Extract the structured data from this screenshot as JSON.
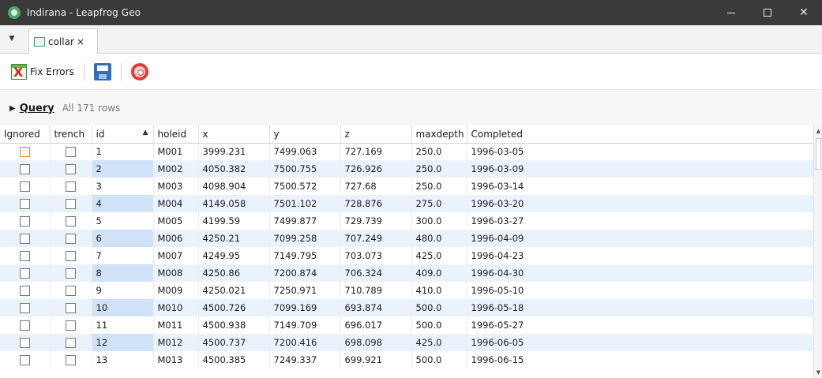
{
  "window": {
    "title": "Indirana - Leapfrog Geo",
    "minimize": "—",
    "maximize": "□",
    "close": "✕"
  },
  "tabs": [
    {
      "label": "collar",
      "close": "×"
    }
  ],
  "tab_menu_glyph": "▼",
  "toolbar": {
    "fix_errors_label": "Fix Errors",
    "fix_icon_glyph": "X"
  },
  "query": {
    "arrow": "▶",
    "label": "Query",
    "rows_text": "All 171 rows"
  },
  "grid": {
    "columns": [
      "Ignored",
      "trench",
      "id",
      "holeid",
      "x",
      "y",
      "z",
      "maxdepth",
      "Completed"
    ],
    "sort_arrow": "▲",
    "rows": [
      {
        "ignored": false,
        "trench": false,
        "id": "1",
        "holeid": "M001",
        "x": "3999.231",
        "y": "7499.063",
        "z": "727.169",
        "maxdepth": "250.0",
        "completed": "1996-03-05"
      },
      {
        "ignored": false,
        "trench": false,
        "id": "2",
        "holeid": "M002",
        "x": "4050.382",
        "y": "7500.755",
        "z": "726.926",
        "maxdepth": "250.0",
        "completed": "1996-03-09"
      },
      {
        "ignored": false,
        "trench": false,
        "id": "3",
        "holeid": "M003",
        "x": "4098.904",
        "y": "7500.572",
        "z": "727.68",
        "maxdepth": "250.0",
        "completed": "1996-03-14"
      },
      {
        "ignored": false,
        "trench": false,
        "id": "4",
        "holeid": "M004",
        "x": "4149.058",
        "y": "7501.102",
        "z": "728.876",
        "maxdepth": "275.0",
        "completed": "1996-03-20"
      },
      {
        "ignored": false,
        "trench": false,
        "id": "5",
        "holeid": "M005",
        "x": "4199.59",
        "y": "7499.877",
        "z": "729.739",
        "maxdepth": "300.0",
        "completed": "1996-03-27"
      },
      {
        "ignored": false,
        "trench": false,
        "id": "6",
        "holeid": "M006",
        "x": "4250.21",
        "y": "7099.258",
        "z": "707.249",
        "maxdepth": "480.0",
        "completed": "1996-04-09"
      },
      {
        "ignored": false,
        "trench": false,
        "id": "7",
        "holeid": "M007",
        "x": "4249.95",
        "y": "7149.795",
        "z": "703.073",
        "maxdepth": "425.0",
        "completed": "1996-04-23"
      },
      {
        "ignored": false,
        "trench": false,
        "id": "8",
        "holeid": "M008",
        "x": "4250.86",
        "y": "7200.874",
        "z": "706.324",
        "maxdepth": "409.0",
        "completed": "1996-04-30"
      },
      {
        "ignored": false,
        "trench": false,
        "id": "9",
        "holeid": "M009",
        "x": "4250.021",
        "y": "7250.971",
        "z": "710.789",
        "maxdepth": "410.0",
        "completed": "1996-05-10"
      },
      {
        "ignored": false,
        "trench": false,
        "id": "10",
        "holeid": "M010",
        "x": "4500.726",
        "y": "7099.169",
        "z": "693.874",
        "maxdepth": "500.0",
        "completed": "1996-05-18"
      },
      {
        "ignored": false,
        "trench": false,
        "id": "11",
        "holeid": "M011",
        "x": "4500.938",
        "y": "7149.709",
        "z": "696.017",
        "maxdepth": "500.0",
        "completed": "1996-05-27"
      },
      {
        "ignored": false,
        "trench": false,
        "id": "12",
        "holeid": "M012",
        "x": "4500.737",
        "y": "7200.416",
        "z": "698.098",
        "maxdepth": "425.0",
        "completed": "1996-06-05"
      },
      {
        "ignored": false,
        "trench": false,
        "id": "13",
        "holeid": "M013",
        "x": "4500.385",
        "y": "7249.337",
        "z": "699.921",
        "maxdepth": "500.0",
        "completed": "1996-06-15"
      }
    ]
  },
  "colors": {
    "titlebar": "#3a3a3a",
    "row_alt": "#eaf3fc",
    "id_alt": "#cfe2f7",
    "accent": "#2f6fb8"
  }
}
